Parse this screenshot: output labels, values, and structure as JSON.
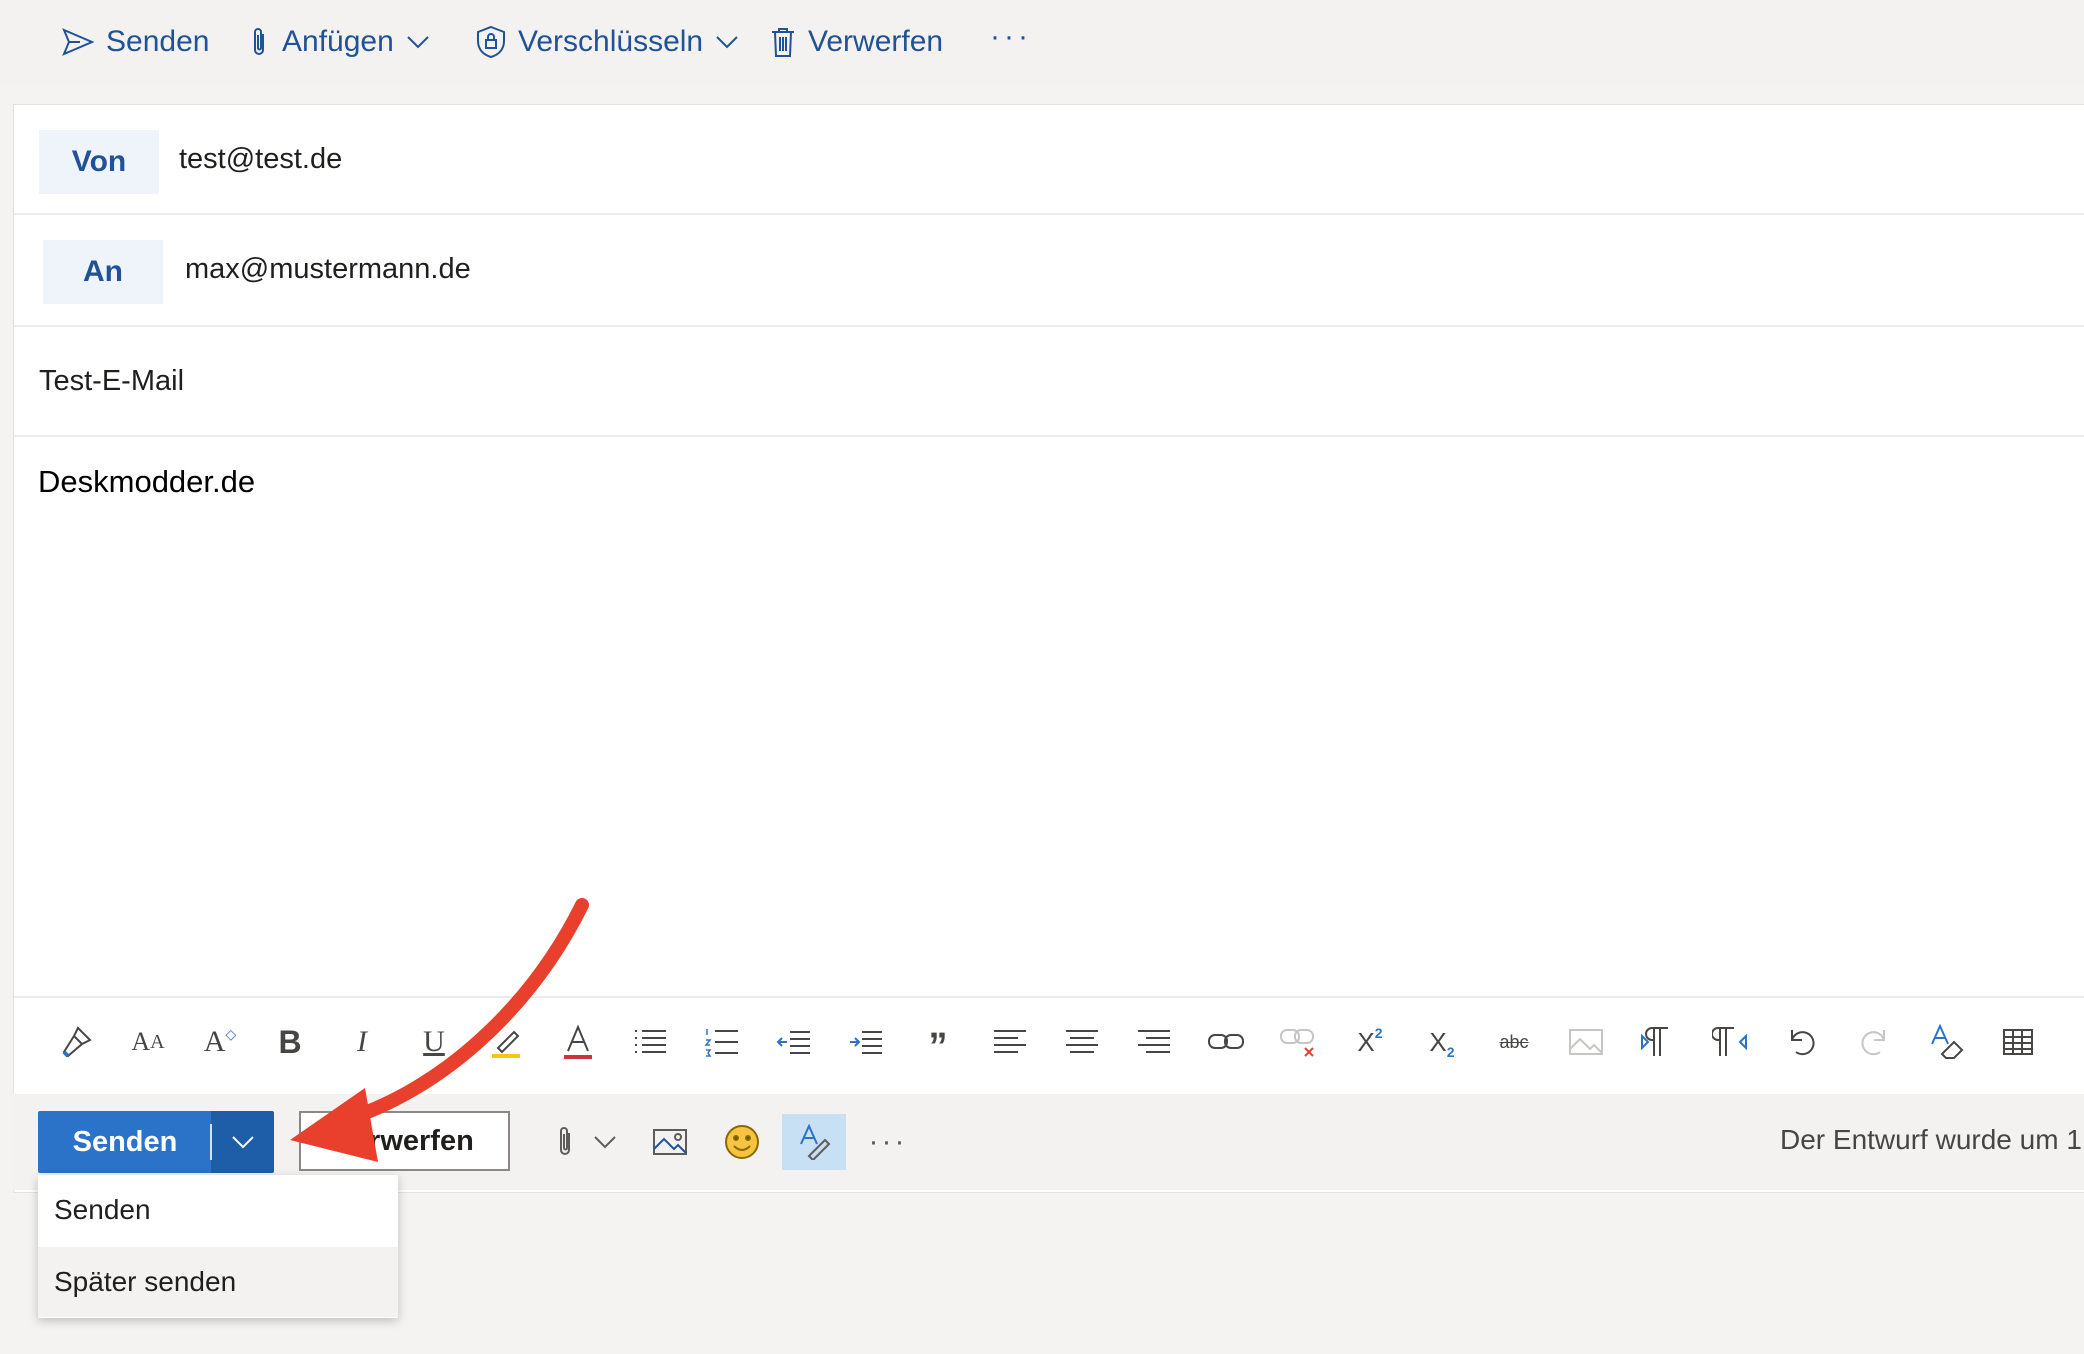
{
  "command_bar": {
    "send_label": "Senden",
    "attach_label": "Anfügen",
    "encrypt_label": "Verschlüsseln",
    "discard_label": "Verwerfen",
    "more_label": "···"
  },
  "compose": {
    "from_label": "Von",
    "from_value": "test@test.de",
    "to_label": "An",
    "to_value": "max@mustermann.de",
    "subject": "Test-E-Mail",
    "body": "Deskmodder.de"
  },
  "bottom_bar": {
    "send_label": "Senden",
    "discard_label": "Verwerfen",
    "more_label": "···",
    "draft_status": "Der Entwurf wurde um 1"
  },
  "send_menu": {
    "items": [
      "Senden",
      "Später senden"
    ],
    "highlighted": "Später senden"
  },
  "colors": {
    "accent": "#2b72c9",
    "accent_dark": "#1e5ea8",
    "link_blue": "#1f5296",
    "annotation_arrow": "#e8402c"
  }
}
